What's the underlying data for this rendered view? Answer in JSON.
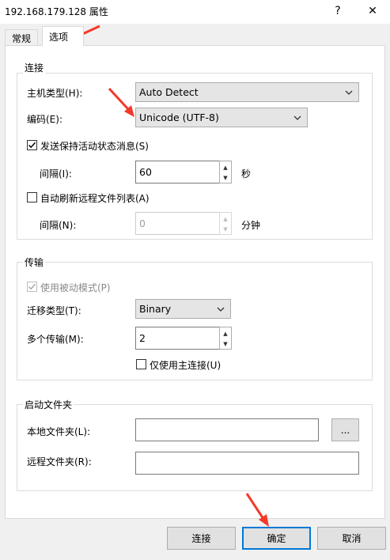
{
  "window": {
    "title": "192.168.179.128 属性",
    "help_label": "?",
    "close_label": "✕"
  },
  "tabs": [
    {
      "label": "常规",
      "active": false
    },
    {
      "label": "选项",
      "active": true
    }
  ],
  "connection": {
    "group_title": "连接",
    "host_type_label": "主机类型(H):",
    "host_type_value": "Auto Detect",
    "encoding_label": "编码(E):",
    "encoding_value": "Unicode (UTF-8)",
    "keepalive_label": "发送保持活动状态消息(S)",
    "keepalive_checked": true,
    "interval_label": "间隔(I):",
    "interval_value": "60",
    "interval_unit": "秒",
    "auto_refresh_label": "自动刷新远程文件列表(A)",
    "auto_refresh_checked": false,
    "refresh_interval_label": "间隔(N):",
    "refresh_interval_value": "0",
    "refresh_interval_unit": "分钟"
  },
  "transfer": {
    "group_title": "传输",
    "passive_label": "使用被动模式(P)",
    "passive_checked": true,
    "passive_disabled": true,
    "type_label": "迁移类型(T):",
    "type_value": "Binary",
    "multi_label": "多个传输(M):",
    "multi_value": "2",
    "main_conn_label": "仅使用主连接(U)",
    "main_conn_checked": false
  },
  "startup": {
    "group_title": "启动文件夹",
    "local_label": "本地文件夹(L):",
    "local_value": "",
    "browse_label": "...",
    "remote_label": "远程文件夹(R):",
    "remote_value": ""
  },
  "buttons": {
    "connect": "连接",
    "ok": "确定",
    "cancel": "取消"
  },
  "colors": {
    "annotation_arrow": "#f23a2a",
    "default_button_border": "#0078d7"
  }
}
